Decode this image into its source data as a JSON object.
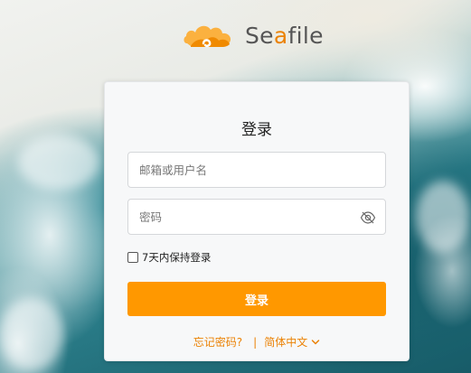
{
  "logo": {
    "prefix": "Se",
    "accent": "a",
    "suffix": "file"
  },
  "login": {
    "title": "登录",
    "username_placeholder": "邮箱或用户名",
    "password_placeholder": "密码",
    "remember_label": "7天内保持登录",
    "remember_checked": false,
    "submit_label": "登录",
    "forgot_label": "忘记密码?",
    "separator": "|",
    "language_label": "简体中文"
  },
  "icons": {
    "logo": "seafile-cloud-icon",
    "password_toggle": "eye-off-icon",
    "language_dropdown": "chevron-down-icon"
  },
  "colors": {
    "accent": "#ff9800",
    "link": "#eb8205",
    "card_bg": "#f7f8f9"
  }
}
